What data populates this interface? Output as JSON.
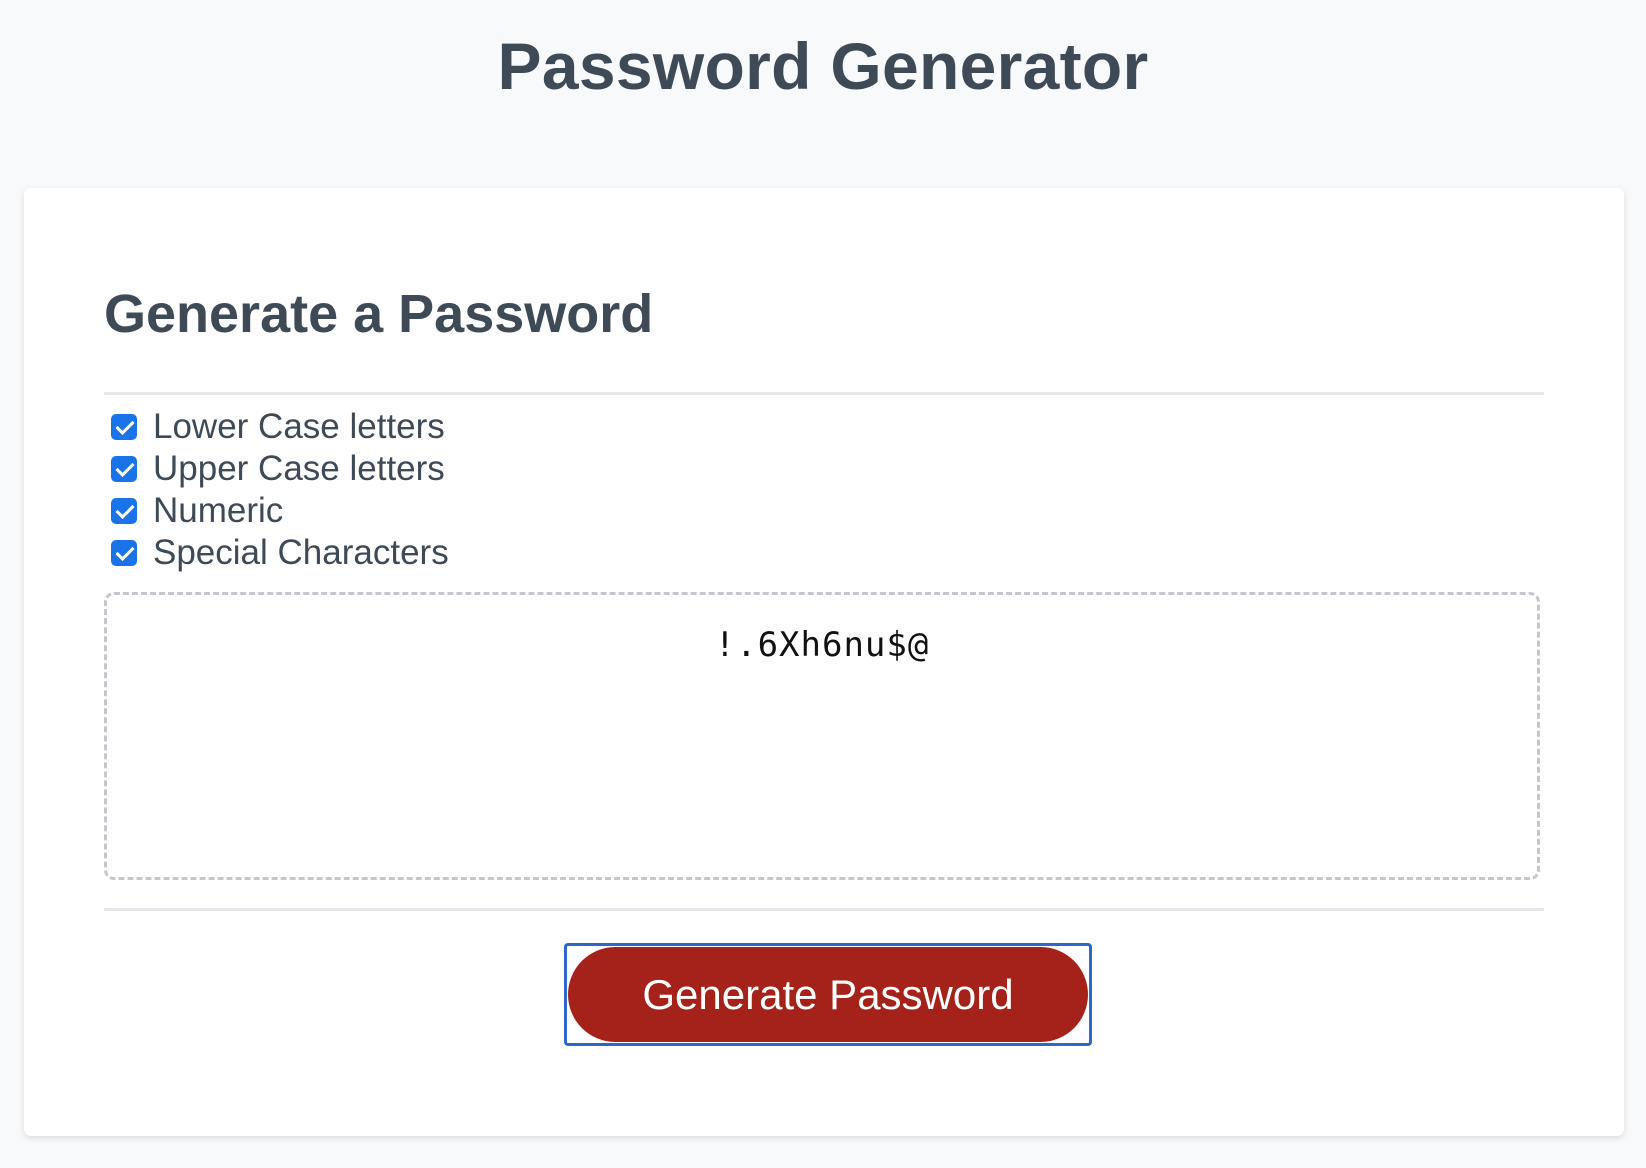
{
  "header": {
    "title": "Password Generator"
  },
  "card": {
    "title": "Generate a Password",
    "options": [
      {
        "label": "Lower Case letters",
        "checked": true
      },
      {
        "label": "Upper Case letters",
        "checked": true
      },
      {
        "label": "Numeric",
        "checked": true
      },
      {
        "label": "Special Characters",
        "checked": true
      }
    ],
    "password": "!.6Xh6nu$@",
    "generate_label": "Generate Password"
  },
  "colors": {
    "background": "#f8f9fa",
    "text": "#3f4a57",
    "checkbox": "#1a73e8",
    "button": "#a5221a",
    "button_focus": "#2e67c9"
  },
  "icons": {
    "checkbox": "checkmark-icon"
  }
}
